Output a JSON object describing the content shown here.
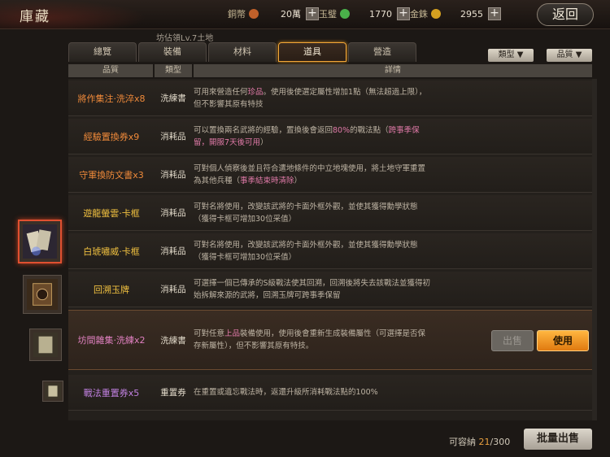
{
  "header": {
    "title": "庫藏",
    "back_label": "返回",
    "subtitle": "坊佔領Lv.7土地",
    "currencies": [
      {
        "label": "銅幣",
        "value": "20萬",
        "color": "#c0602a",
        "icon": "copper-coin-icon"
      },
      {
        "label": "玉璧",
        "value": "1770",
        "color": "#4ab04a",
        "icon": "jade-icon"
      },
      {
        "label": "金銖",
        "value": "2955",
        "color": "#d4a020",
        "icon": "gold-coin-icon"
      }
    ],
    "plus_label": "+"
  },
  "tabs": [
    {
      "label": "總覽",
      "active": false
    },
    {
      "label": "裝備",
      "active": false
    },
    {
      "label": "材料",
      "active": false
    },
    {
      "label": "道具",
      "active": true
    },
    {
      "label": "營造",
      "active": false
    }
  ],
  "filters": {
    "type_label": "類型 ▼",
    "quality_label": "品質 ▼"
  },
  "columns": {
    "quality": "品質",
    "type": "類型",
    "details": "詳情"
  },
  "items": [
    {
      "name": "將作集注·洗淬x8",
      "type": "洗練書",
      "desc": "可用來營造任何{珍品}。使用後使選定屬性增加1點（無法超過上限），但不影響其原有特技"
    },
    {
      "name": "經驗置換券x9",
      "type": "消耗品",
      "desc": "可以置換兩名武將的經驗，置換後會返回{80%}的戰法點（{跨事季保留，開服7天後可用}）"
    },
    {
      "name": "守軍換防文書x3",
      "type": "消耗品",
      "desc": "可對個人偵察後並且符合遣地條件的中立地塊使用，將土地守軍重置為其他兵種（{事季結束時清除}）"
    },
    {
      "name": "遊龍螢雲·卡框",
      "type": "消耗品",
      "desc": "可對名將使用，改變該武將的卡面外框外觀，並使其獲得勳學狀態（獲得卡框可增加30位采值）"
    },
    {
      "name": "白琥嘯威·卡框",
      "type": "消耗品",
      "desc": "可對名將使用，改變該武將的卡面外框外觀，並使其獲得勳學狀態（獲得卡框可增加30位采值）"
    },
    {
      "name": "回溯玉牌",
      "type": "消耗品",
      "desc": "可選擇一個已傳承的S級戰法使其回溯，回溯後將失去該戰法並獲得初始拆解來源的武將，回溯玉牌可跨事季保留"
    },
    {
      "name": "坊間雜集·洗練x2",
      "type": "洗練書",
      "desc": "可對任意{上品}裝備使用，使用後會重新生成裝備屬性（可選擇是否保存新屬性），但不影響其原有特技。"
    },
    {
      "name": "戰法重置券x5",
      "type": "重置券",
      "desc": "在重置或遺忘戰法時，返還升級所消耗戰法點的100%"
    }
  ],
  "selected_item_index": 6,
  "buttons": {
    "sell": "出售",
    "use": "使用",
    "bulk_sell": "批量出售"
  },
  "capacity": {
    "label": "可容納",
    "used": "21",
    "total": "/300"
  }
}
